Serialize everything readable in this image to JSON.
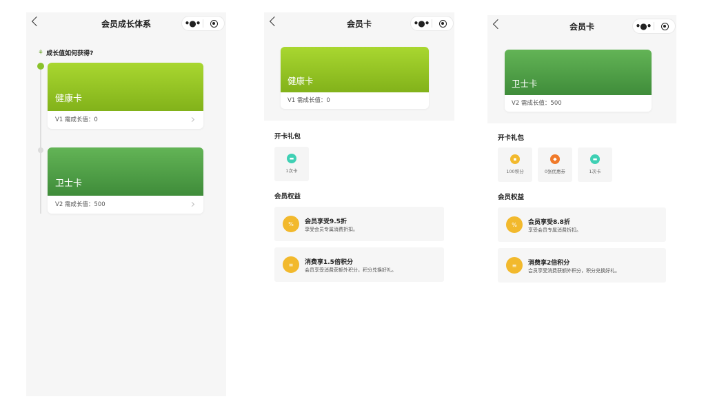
{
  "growth_page": {
    "title": "会员成长体系",
    "back_icon": "chevron-left-icon",
    "more_label": "•●•",
    "section_title": "成长值如何获得?",
    "cards": [
      {
        "name": "健康卡",
        "level_text": "V1 需成长值：0",
        "color": "#9ccc2a"
      },
      {
        "name": "卫士卡",
        "level_text": "V2 需成长值：500",
        "color": "#52a549"
      }
    ]
  },
  "card_page_health": {
    "title": "会员卡",
    "more_label": "•●•",
    "card_name": "健康卡",
    "level_text": "V1 需成长值：0",
    "gift_title": "开卡礼包",
    "gifts": [
      {
        "label": "1次卡",
        "icon": "card-icon",
        "color": "#3fd0b4"
      }
    ],
    "benefits_title": "会员权益",
    "benefits": [
      {
        "title": "会员享受9.5折",
        "desc": "享受会员专属消费折扣。",
        "icon": "percent-icon",
        "glyph": "%"
      },
      {
        "title": "消费享1.5倍积分",
        "desc": "会员享受消费获额外积分，积分兑换好礼。",
        "icon": "coins-icon",
        "glyph": "≡"
      }
    ]
  },
  "card_page_guard": {
    "title": "会员卡",
    "more_label": "•●•",
    "card_name": "卫士卡",
    "level_text": "V2 需成长值：500",
    "gift_title": "开卡礼包",
    "gifts": [
      {
        "label": "100积分",
        "icon": "points-icon",
        "color": "#f2b92d"
      },
      {
        "label": "0张优惠券",
        "icon": "coupon-icon",
        "color": "#f07a2a"
      },
      {
        "label": "1次卡",
        "icon": "card-icon",
        "color": "#3fd0b4"
      }
    ],
    "benefits_title": "会员权益",
    "benefits": [
      {
        "title": "会员享受8.8折",
        "desc": "享受会员专属消费折扣。",
        "icon": "percent-icon",
        "glyph": "%"
      },
      {
        "title": "消费享2倍积分",
        "desc": "会员享受消费获额外积分，积分兑换好礼。",
        "icon": "coins-icon",
        "glyph": "≡"
      }
    ]
  }
}
